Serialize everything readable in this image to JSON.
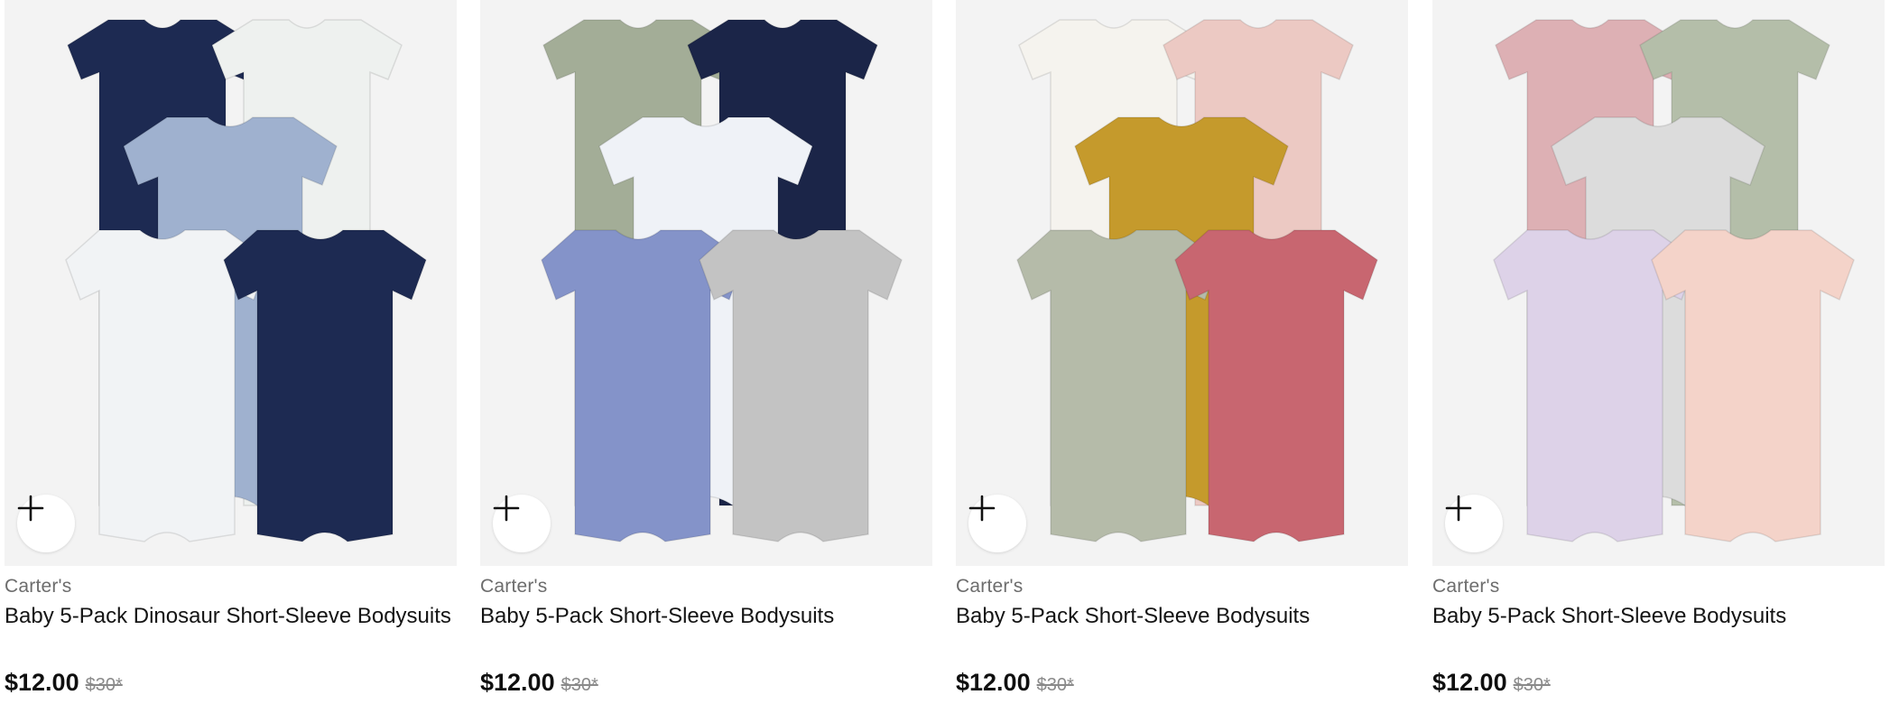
{
  "products": [
    {
      "brand": "Carter's",
      "title": "Baby 5-Pack Dinosaur Short-Sleeve Bodysuits",
      "price": "$12.00",
      "original_price": "$30*",
      "colors": [
        "#1d2a52",
        "#eef1ef",
        "#9fb1cf",
        "#f1f3f5",
        "#1d2a52"
      ]
    },
    {
      "brand": "Carter's",
      "title": "Baby 5-Pack Short-Sleeve Bodysuits",
      "price": "$12.00",
      "original_price": "$30*",
      "colors": [
        "#a3ad97",
        "#1b2548",
        "#eff2f7",
        "#8493c9",
        "#c3c3c3"
      ]
    },
    {
      "brand": "Carter's",
      "title": "Baby 5-Pack Short-Sleeve Bodysuits",
      "price": "$12.00",
      "original_price": "$30*",
      "colors": [
        "#f5f3ee",
        "#ecc9c3",
        "#c59a2c",
        "#b5bba9",
        "#c86670"
      ]
    },
    {
      "brand": "Carter's",
      "title": "Baby 5-Pack Short-Sleeve Bodysuits",
      "price": "$12.00",
      "original_price": "$30*",
      "colors": [
        "#ddb0b4",
        "#b4bea9",
        "#dcdcdc",
        "#ddd2e8",
        "#f4d3c9"
      ]
    }
  ],
  "icons": {
    "add": "plus-icon"
  }
}
